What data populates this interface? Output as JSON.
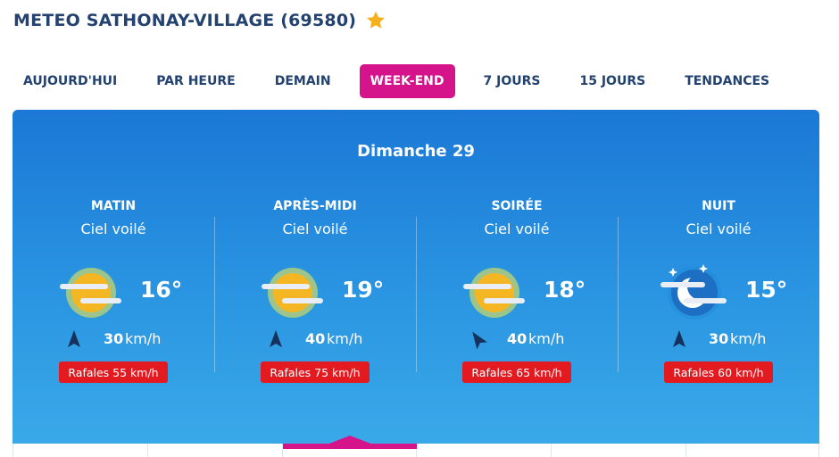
{
  "header": {
    "title": "METEO SATHONAY-VILLAGE (69580)",
    "favorite_icon": "star-icon",
    "accent": "#f5b11c"
  },
  "tabs": [
    {
      "label": "AUJOURD'HUI",
      "active": false
    },
    {
      "label": "PAR HEURE",
      "active": false
    },
    {
      "label": "DEMAIN",
      "active": false
    },
    {
      "label": "WEEK-END",
      "active": true
    },
    {
      "label": "7 JOURS",
      "active": false
    },
    {
      "label": "15 JOURS",
      "active": false
    },
    {
      "label": "TENDANCES",
      "active": false
    }
  ],
  "colors": {
    "active_tab": "#d5138a",
    "panel_top": "#1b78d6",
    "gust_badge": "#e41a21"
  },
  "forecast": {
    "day": "Dimanche 29",
    "periods": [
      {
        "name": "MATIN",
        "condition": "Ciel voilé",
        "icon": "veiled-sun-icon",
        "temp": "16°",
        "wind_speed": "30",
        "wind_unit": "km/h",
        "wind_icon": "wind-direction-arrow-icon",
        "gusts": "Rafales 55 km/h"
      },
      {
        "name": "APRÈS-MIDI",
        "condition": "Ciel voilé",
        "icon": "veiled-sun-icon",
        "temp": "19°",
        "wind_speed": "40",
        "wind_unit": "km/h",
        "wind_icon": "wind-direction-arrow-icon",
        "gusts": "Rafales 75 km/h"
      },
      {
        "name": "SOIRÉE",
        "condition": "Ciel voilé",
        "icon": "veiled-sun-icon",
        "temp": "18°",
        "wind_speed": "40",
        "wind_unit": "km/h",
        "wind_icon": "wind-direction-arrow-icon",
        "gusts": "Rafales 65 km/h"
      },
      {
        "name": "NUIT",
        "condition": "Ciel voilé",
        "icon": "veiled-moon-icon",
        "temp": "15°",
        "wind_speed": "30",
        "wind_unit": "km/h",
        "wind_icon": "wind-direction-arrow-icon",
        "gusts": "Rafales 60 km/h"
      }
    ]
  }
}
